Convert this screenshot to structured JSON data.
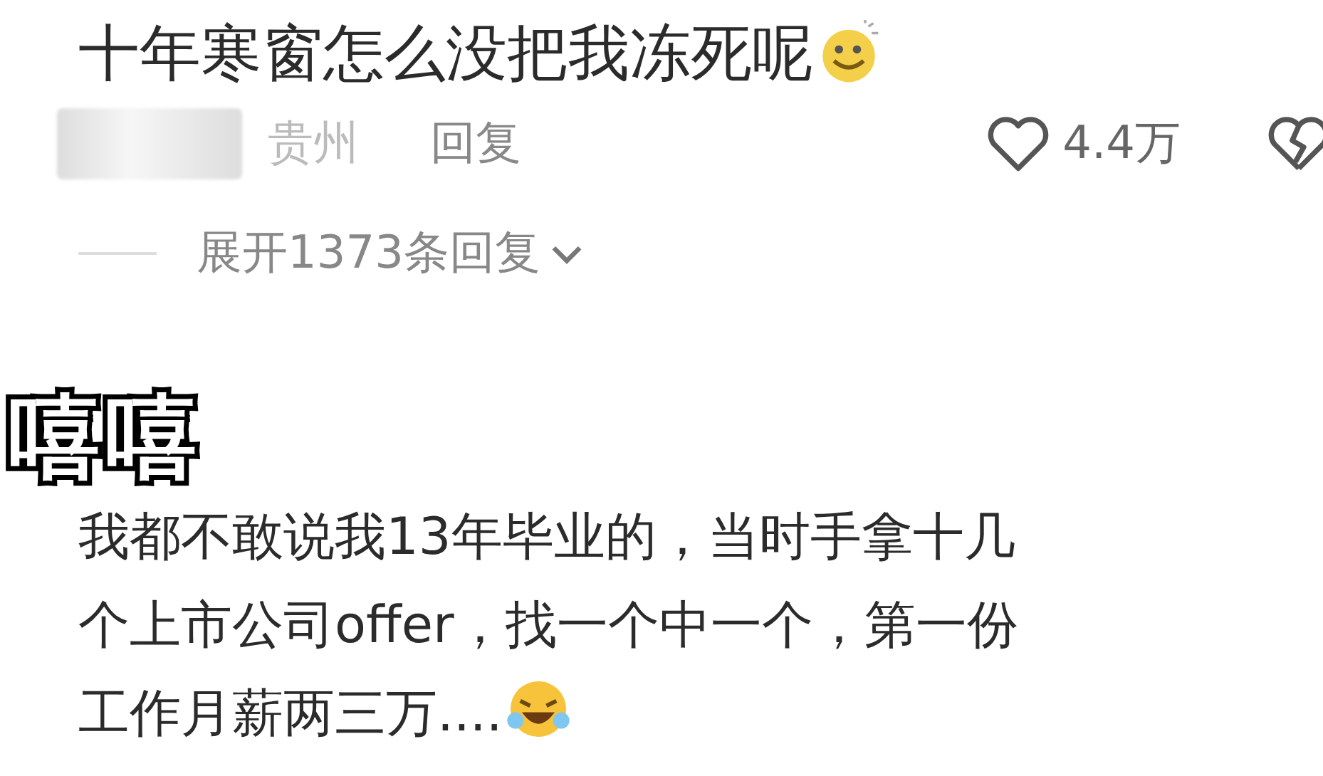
{
  "comments": [
    {
      "text": "十年寒窗怎么没把我冻死呢",
      "emoji": {
        "kind": "smile"
      },
      "location": "贵州",
      "reply": "回复",
      "likes": "4.4万",
      "replies_toggle": "展开1373条回复"
    },
    {
      "sticker": "嘻嘻",
      "lines": [
        "我都不敢说我13年毕业的，当时手拿十几",
        "个上市公司offer，找一个中一个，第一份",
        "工作月薪两三万...."
      ],
      "emoji": {
        "kind": "laugh"
      }
    }
  ]
}
